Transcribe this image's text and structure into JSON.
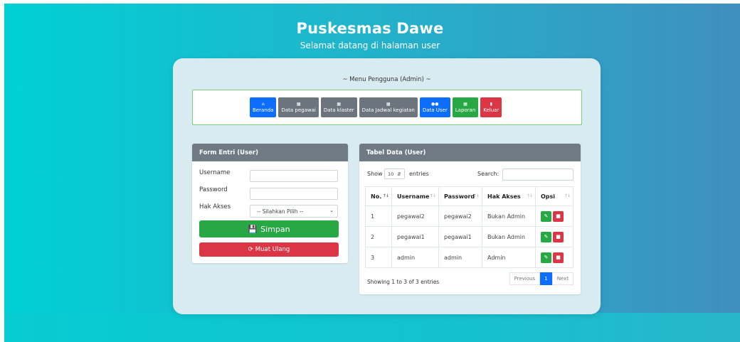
{
  "header": {
    "title": "Puskesmas Dawe",
    "subtitle": "Selamat datang di halaman user"
  },
  "menu": {
    "heading": "~ Menu Pengguna (Admin) ~",
    "items": [
      {
        "label": "Beranda",
        "color": "#0d6efd",
        "icon": "home-icon"
      },
      {
        "label": "Data pegawai",
        "color": "#6c757d",
        "icon": "table-icon"
      },
      {
        "label": "Data klaster",
        "color": "#6c757d",
        "icon": "table-icon"
      },
      {
        "label": "Data Jadwal kegiatan",
        "color": "#6c757d",
        "icon": "table-icon"
      },
      {
        "label": "Data User",
        "color": "#0d6efd",
        "icon": "users-icon"
      },
      {
        "label": "Laporan",
        "color": "#28a745",
        "icon": "table-icon"
      },
      {
        "label": "Keluar",
        "color": "#dc3545",
        "icon": "bookmark-icon"
      }
    ]
  },
  "form": {
    "title": "Form Entri (User)",
    "username_label": "Username",
    "username_value": "",
    "password_label": "Password",
    "password_value": "",
    "hak_akses_label": "Hak Akses",
    "hak_akses_selected": "-- Silahkan Pilih --",
    "save_label": "Simpan",
    "reload_label": "Muat Ulang"
  },
  "table": {
    "title": "Tabel Data (User)",
    "show_label": "Show",
    "entries_value": "10",
    "entries_label": "entries",
    "search_label": "Search:",
    "search_value": "",
    "columns": [
      "No.",
      "Username",
      "Password",
      "Hak Akses",
      "Opsi"
    ],
    "rows": [
      {
        "no": "1",
        "username": "pegawai2",
        "password": "pegawai2",
        "hak_akses": "Bukan Admin"
      },
      {
        "no": "2",
        "username": "pegawai1",
        "password": "pegawai1",
        "hak_akses": "Bukan Admin"
      },
      {
        "no": "3",
        "username": "admin",
        "password": "admin",
        "hak_akses": "Admin"
      }
    ],
    "info": "Showing 1 to 3 of 3 entries",
    "pagination": {
      "previous": "Previous",
      "current": "1",
      "next": "Next"
    }
  },
  "colors": {
    "primary": "#0d6efd",
    "success": "#28a745",
    "danger": "#dc3545",
    "secondary": "#6c757d",
    "panel_header": "#707a84"
  }
}
